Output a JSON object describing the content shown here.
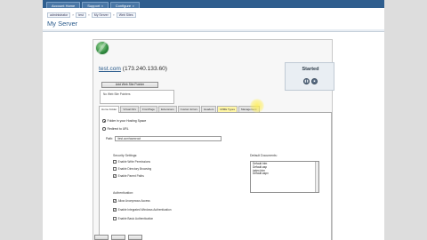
{
  "nav": {
    "tabs": [
      {
        "label": "Account Home"
      },
      {
        "label": "Support",
        "caret": "▾"
      },
      {
        "label": "Configure",
        "caret": "▾"
      }
    ]
  },
  "breadcrumb": {
    "items": [
      "administrator",
      "test",
      "My Server",
      "Web Sites"
    ],
    "separator": "»"
  },
  "page_title": "My Server",
  "server": {
    "host_link": "test.com",
    "ip": "(173.240.133.60)",
    "add_button_label": "Add Web Site Pointer",
    "note": "No Web Site Pointers"
  },
  "status": {
    "label": "Started"
  },
  "tabs": [
    {
      "label": "Home Folder",
      "active": true
    },
    {
      "label": "Virtual Dirs"
    },
    {
      "label": "FrontPage"
    },
    {
      "label": "Extensions"
    },
    {
      "label": "Custom Errors"
    },
    {
      "label": "Headers"
    },
    {
      "label": "MIME Types",
      "highlight": true
    },
    {
      "label": "Management"
    }
  ],
  "home_folder": {
    "option_folder": "Folder in your Hosting Space",
    "option_redirect": "Redirect to URL",
    "path_label": "Path:",
    "path_value": "\\test.com\\wwwroot"
  },
  "security": {
    "title": "Security Settings:",
    "items": [
      {
        "label": "Enable Write Permissions",
        "checked": false
      },
      {
        "label": "Enable Directory Browsing",
        "checked": false
      },
      {
        "label": "Enable Parent Paths",
        "checked": true
      }
    ]
  },
  "authentication": {
    "title": "Authentication:",
    "items": [
      {
        "label": "Allow Anonymous Access",
        "checked": true
      },
      {
        "label": "Enable Integrated Windows Authentication",
        "checked": true
      },
      {
        "label": "Enable Basic Authentication",
        "checked": false
      }
    ]
  },
  "default_documents": {
    "title": "Default Documents:",
    "items": [
      "Default.htm",
      "Default.asp",
      "index.htm",
      "Default.aspx"
    ]
  },
  "colors": {
    "nav_bar": "#2f5e8e",
    "title_text": "#2c5c8c",
    "highlight": "#ffee50"
  }
}
